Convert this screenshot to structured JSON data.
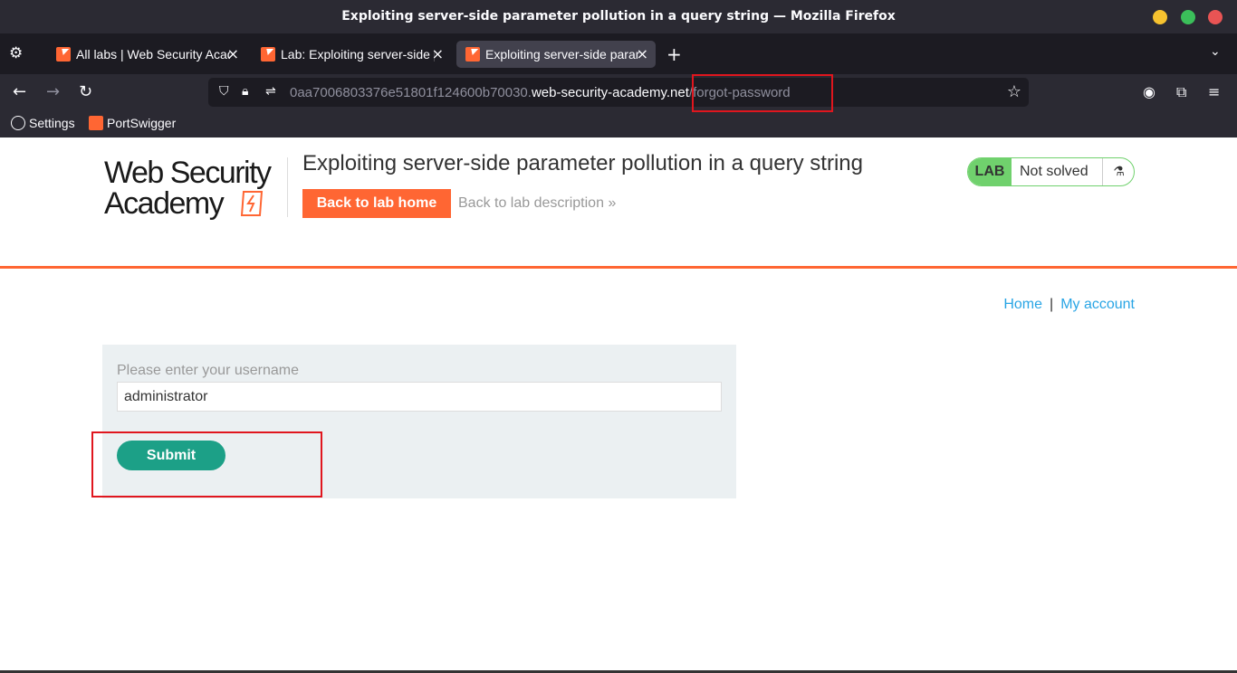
{
  "window": {
    "title": "Exploiting server-side parameter pollution in a query string — Mozilla Firefox"
  },
  "tabs": [
    {
      "label": "All labs | Web Security Academy"
    },
    {
      "label": "Lab: Exploiting server-side parameter pollution in a query string"
    },
    {
      "label": "Exploiting server-side parameter pollution in a query string"
    }
  ],
  "navbar": {
    "url_prefix": "0aa7006803376e51801f124600b70030.",
    "url_host": "web-security-academy.net",
    "url_path": "/forgot-password"
  },
  "bookmarks": [
    {
      "label": "Settings"
    },
    {
      "label": "PortSwigger"
    }
  ],
  "page": {
    "logo_line1": "Web Security",
    "logo_line2": "Academy",
    "lab_title": "Exploiting server-side parameter pollution in a query string",
    "back_button": "Back to lab home",
    "back_description": "Back to lab description",
    "lab_tag": "LAB",
    "lab_state": "Not solved",
    "nav_home": "Home",
    "nav_separator": "|",
    "nav_account": "My account",
    "form_label": "Please enter your username",
    "username_value": "administrator",
    "submit_label": "Submit"
  },
  "colors": {
    "accent_orange": "#ff6633",
    "submit_green": "#1ca087",
    "lab_green": "#70d16d",
    "link_blue": "#29a5e5",
    "highlight_red": "#e0161e"
  }
}
